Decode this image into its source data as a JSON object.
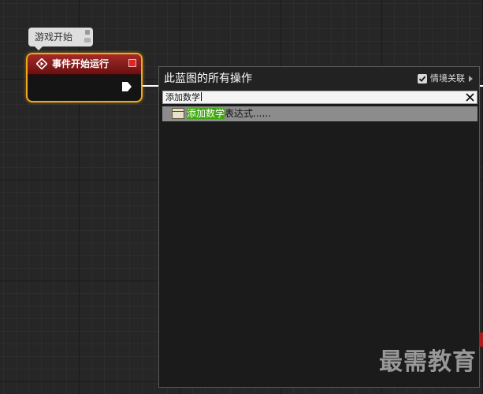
{
  "graph": {
    "comment_text": "游戏开始",
    "event_node": {
      "title": "事件开始运行",
      "header_color": "#a42a2a",
      "selection_color": "#f0a81c"
    }
  },
  "action_menu": {
    "title": "此蓝图的所有操作",
    "context_sensitive": {
      "label": "情境关联",
      "checked": true
    },
    "search": {
      "value": "添加数学"
    },
    "results": [
      {
        "match": "添加数学",
        "rest": "表达式......",
        "icon": "math-expression-icon"
      }
    ],
    "highlight_color": "#3fa80e"
  },
  "watermark": {
    "text": "最需教育"
  }
}
